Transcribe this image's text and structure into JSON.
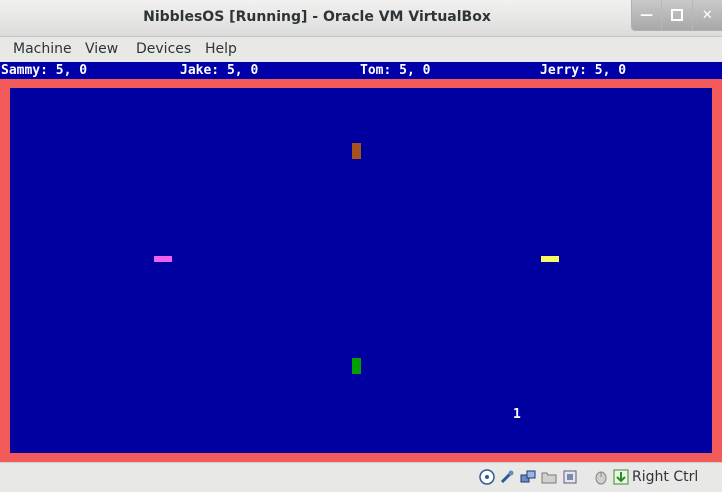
{
  "window": {
    "title": "NibblesOS [Running] - Oracle VM VirtualBox"
  },
  "menu": {
    "items": [
      "Machine",
      "View",
      "Devices",
      "Help"
    ]
  },
  "scores": {
    "sammy": "Sammy: 5, 0",
    "jake": "Jake: 5, 0",
    "tom": "Tom: 5, 0",
    "jerry": "Jerry: 5, 0"
  },
  "game": {
    "level": "1",
    "colors": {
      "border": "#f25a5a",
      "field": "#0000a0",
      "brown": "#a6521e",
      "magenta": "#f060f0",
      "yellow": "#f8f860",
      "green": "#00a000"
    }
  },
  "status": {
    "host_key": "Right Ctrl",
    "icons": [
      "optical-drive-icon",
      "usb-icon",
      "network-icon",
      "shared-folders-icon",
      "video-capture-icon",
      "cpu-icon",
      "mouse-integration-icon",
      "keyboard-capture-icon"
    ]
  }
}
